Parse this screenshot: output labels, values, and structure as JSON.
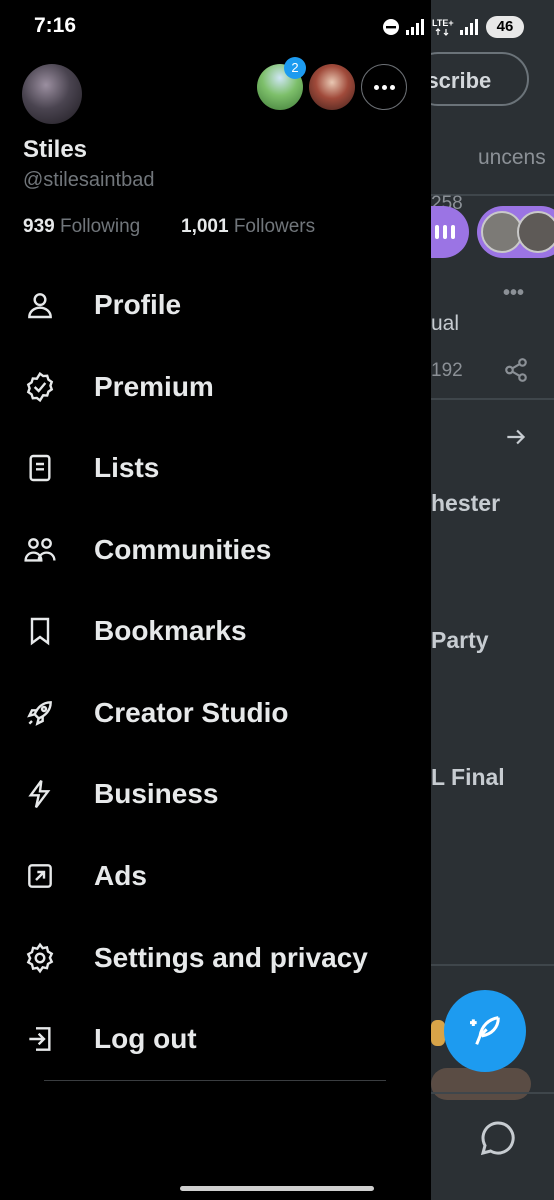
{
  "status_bar": {
    "time": "7:16",
    "battery": "46"
  },
  "background": {
    "subscribe": "bscribe",
    "tab": "uncens",
    "stat_1": "258",
    "text_1": "ual",
    "stat_2": "192",
    "trend_1": "hester",
    "trend_2": "Party",
    "trend_3": "L Final"
  },
  "profile": {
    "name": "Stiles",
    "handle": "@stilesaintbad",
    "following_count": "939",
    "following_label": "Following",
    "followers_count": "1,001",
    "followers_label": "Followers",
    "notification_count": "2"
  },
  "menu": {
    "profile": "Profile",
    "premium": "Premium",
    "lists": "Lists",
    "communities": "Communities",
    "bookmarks": "Bookmarks",
    "creator_studio": "Creator Studio",
    "business": "Business",
    "ads": "Ads",
    "settings": "Settings and privacy",
    "logout": "Log out"
  },
  "colors": {
    "accent": "#1d9bf0",
    "space": "#9b74e4",
    "muted": "#71767b"
  }
}
